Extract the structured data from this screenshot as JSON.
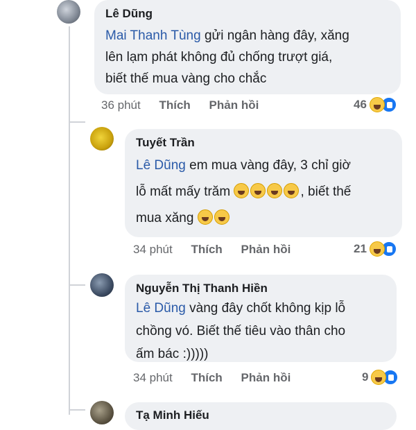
{
  "comments": [
    {
      "author": "Lê Dũng",
      "mention": "Mai Thanh Tùng",
      "lines": [
        " gửi ngân hàng đây, xăng",
        "lên lạm phát không đủ chống trượt giá,",
        "biết thế mua vàng cho chắc"
      ],
      "time": "36 phút",
      "like": "Thích",
      "reply": "Phản hồi",
      "reactions": "46"
    },
    {
      "author": "Tuyết Trần",
      "mention": "Lê Dũng",
      "line1": " em mua vàng đây, 3 chỉ giờ",
      "line2a": "lỗ mất mấy trăm ",
      "line2b": ", biết thế",
      "line3": "mua xăng ",
      "time": "34 phút",
      "like": "Thích",
      "reply": "Phản hồi",
      "reactions": "21"
    },
    {
      "author": "Nguyễn Thị Thanh Hiền",
      "mention": "Lê Dũng",
      "lines": [
        " vàng đây chốt không kịp lỗ",
        "chồng vó. Biết thế tiêu vào thân cho",
        "ấm bác :)))))"
      ],
      "time": "34 phút",
      "like": "Thích",
      "reply": "Phản hồi",
      "reactions": "9"
    },
    {
      "author": "Tạ Minh Hiếu"
    }
  ],
  "icons": {
    "reaction_1": "haha-emoji",
    "reaction_2": "like-emoji",
    "inline": "laughing-emoji"
  }
}
